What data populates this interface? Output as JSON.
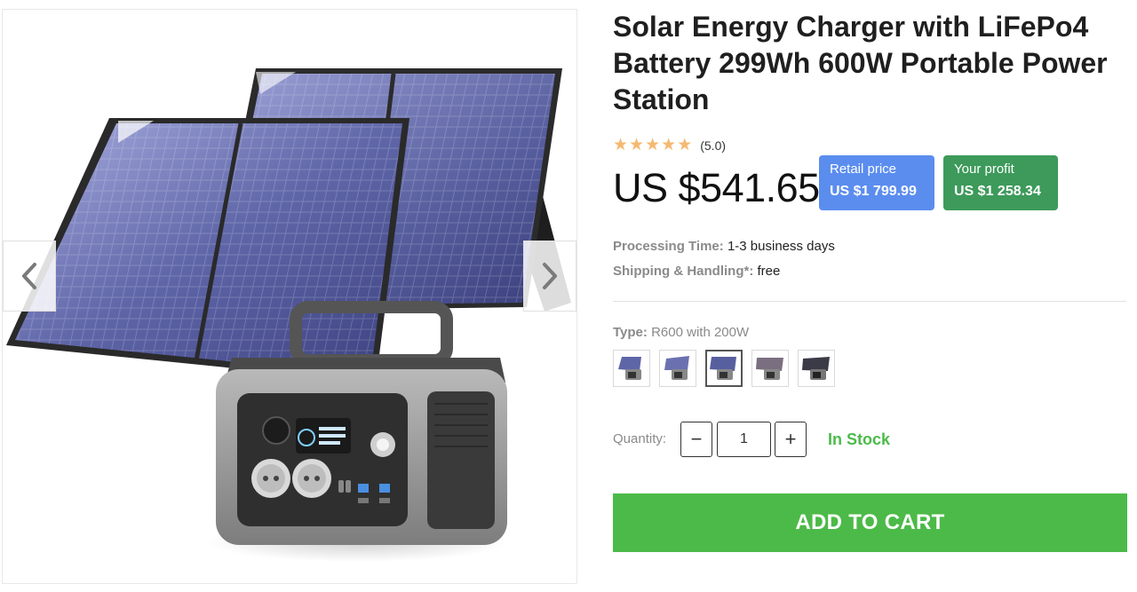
{
  "product": {
    "title": "Solar Energy Charger with LiFePo4 Battery 299Wh 600W Portable Power Station",
    "rating": {
      "stars": 5,
      "value_text": "(5.0)"
    },
    "price": "US $541.65",
    "retail": {
      "label": "Retail price",
      "value": "US $1 799.99"
    },
    "profit": {
      "label": "Your profit",
      "value": "US $1 258.34"
    },
    "processing": {
      "label": "Processing Time:",
      "value": "1-3 business days"
    },
    "shipping": {
      "label": "Shipping & Handling*:",
      "value": "free"
    },
    "type": {
      "label": "Type:",
      "value": "R600 with 200W",
      "variants": [
        "variant-1",
        "variant-2",
        "variant-3",
        "variant-4",
        "variant-5"
      ],
      "selected_index": 2
    },
    "quantity": {
      "label": "Quantity:",
      "value": "1",
      "minus": "−",
      "plus": "+"
    },
    "stock": "In Stock",
    "add_to_cart": "ADD TO CART"
  },
  "gallery": {
    "prev_icon": "chevron-left-icon",
    "next_icon": "chevron-right-icon"
  },
  "colors": {
    "retail_badge": "#5b8def",
    "profit_badge": "#3d9a5a",
    "in_stock": "#4cba4a",
    "add_to_cart": "#4cba48",
    "stars": "#f5b971"
  }
}
